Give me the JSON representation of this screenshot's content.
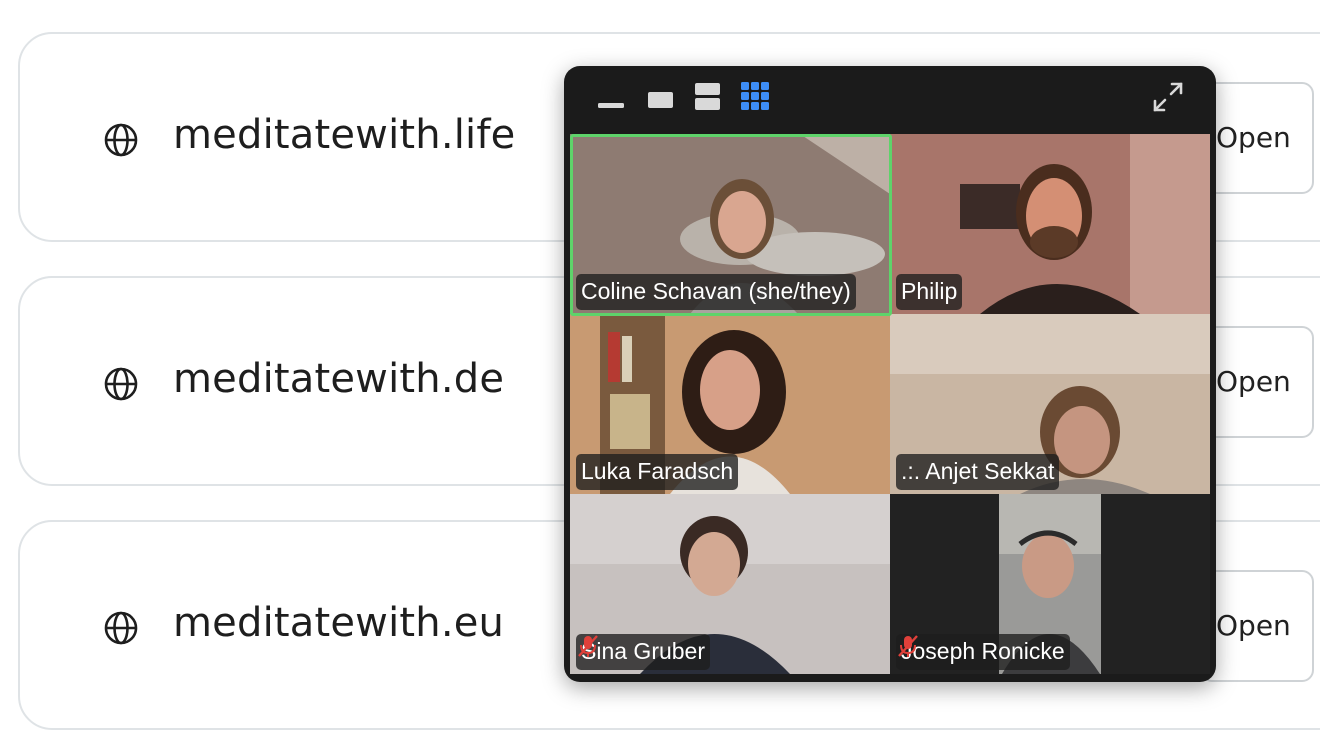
{
  "domains": [
    {
      "name": "meditatewith.life",
      "open_label": "Open"
    },
    {
      "name": "meditatewith.de",
      "open_label": "Open"
    },
    {
      "name": "meditatewith.eu",
      "open_label": "Open"
    }
  ],
  "video_call": {
    "toolbar": {
      "icons": [
        "minimize-icon",
        "speaker-view-icon",
        "stacked-view-icon",
        "gallery-view-icon",
        "expand-icon"
      ],
      "active_view": "gallery",
      "accent": "#3d8ef7"
    },
    "participants": [
      {
        "name": "Coline Schavan (she/they)",
        "muted": false,
        "active_speaker": true
      },
      {
        "name": "Philip",
        "muted": false,
        "active_speaker": false
      },
      {
        "name": "Luka Faradsch",
        "muted": false,
        "active_speaker": false
      },
      {
        "name": ".:. Anjet Sekkat",
        "muted": false,
        "active_speaker": false
      },
      {
        "name": "Sina Gruber",
        "muted": true,
        "active_speaker": false
      },
      {
        "name": "Joseph Ronicke",
        "muted": true,
        "active_speaker": false
      }
    ],
    "colors": {
      "active_speaker_border": "#5ed36a",
      "mute_icon": "#e0403a"
    }
  }
}
